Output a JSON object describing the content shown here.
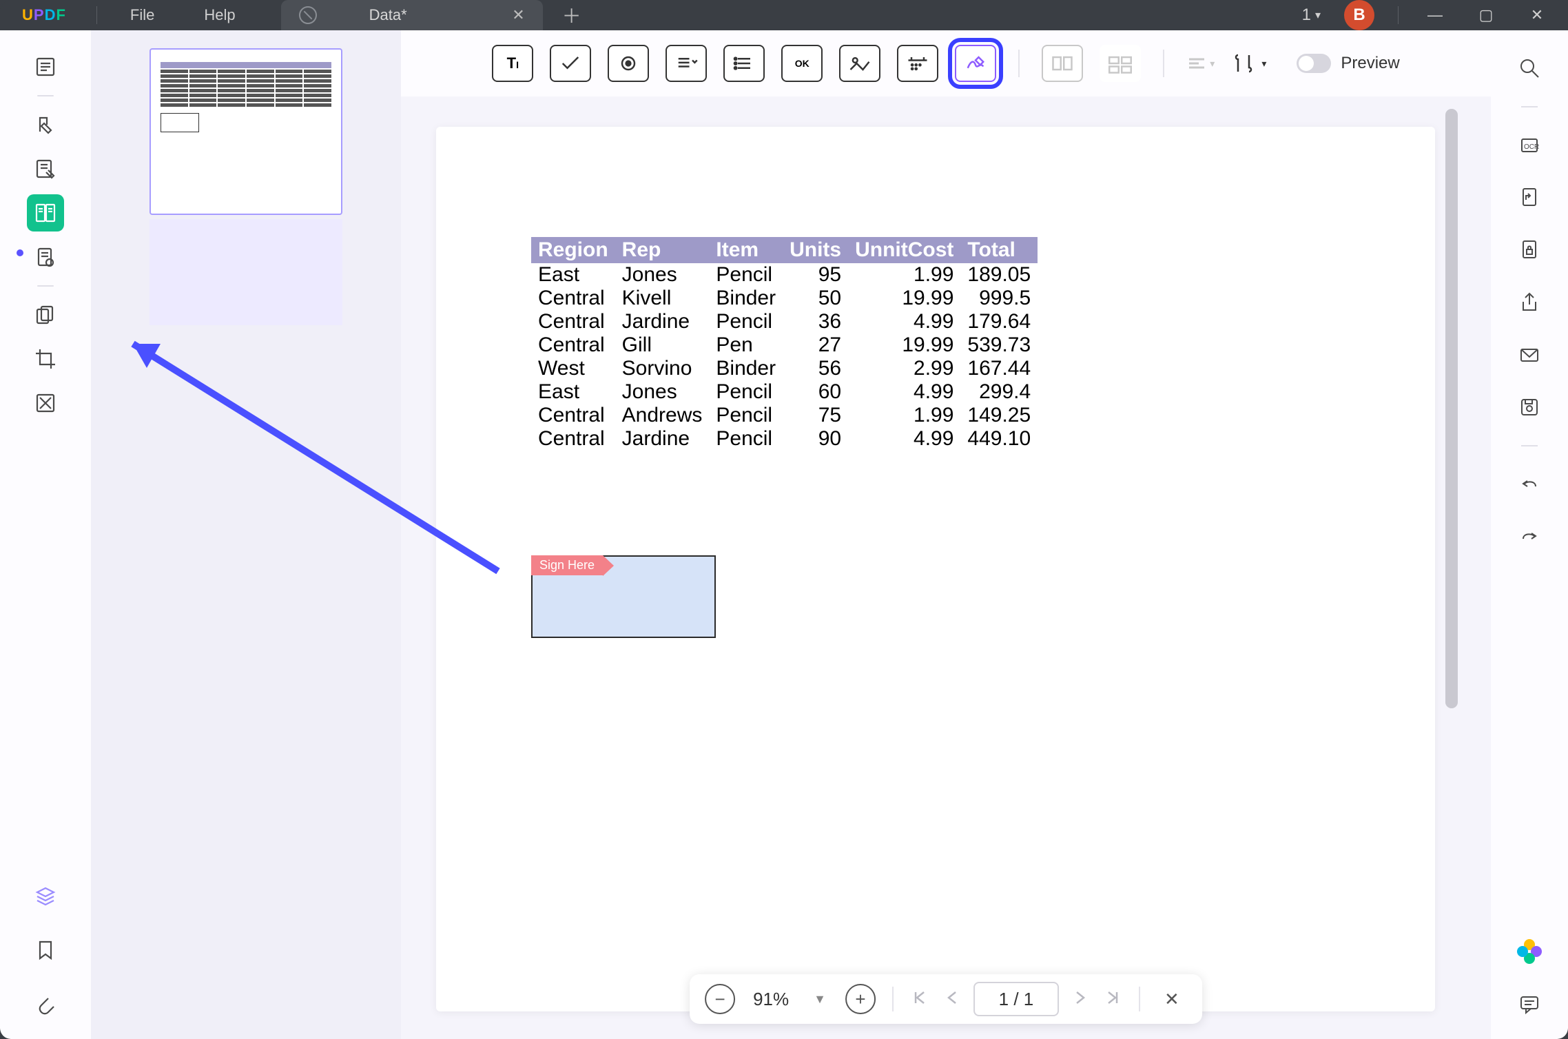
{
  "titlebar": {
    "logo": "UPDF",
    "menu_file": "File",
    "menu_help": "Help",
    "tab_title": "Data*",
    "tab_count": "1",
    "avatar_letter": "B"
  },
  "form_toolbar": {
    "text_field": "Text Field",
    "check_box": "Check Box",
    "radio": "Radio Button",
    "dropdown": "Dropdown",
    "list_box": "List Box",
    "button": "OK",
    "image": "Image Field",
    "date": "Date",
    "signature": "Signature",
    "form_recognize": "Form Field Recognition",
    "highlight_fields": "Highlight Fields",
    "alignment": "Alignment",
    "tools": "Tools",
    "preview_label": "Preview"
  },
  "document": {
    "headers": [
      "Region",
      "Rep",
      "Item",
      "Units",
      "UnnitCost",
      "Total"
    ],
    "rows": [
      [
        "East",
        "Jones",
        "Pencil",
        "95",
        "1.99",
        "189.05"
      ],
      [
        "Central",
        "Kivell",
        "Binder",
        "50",
        "19.99",
        "999.5"
      ],
      [
        "Central",
        "Jardine",
        "Pencil",
        "36",
        "4.99",
        "179.64"
      ],
      [
        "Central",
        "Gill",
        "Pen",
        "27",
        "19.99",
        "539.73"
      ],
      [
        "West",
        "Sorvino",
        "Binder",
        "56",
        "2.99",
        "167.44"
      ],
      [
        "East",
        "Jones",
        "Pencil",
        "60",
        "4.99",
        "299.4"
      ],
      [
        "Central",
        "Andrews",
        "Pencil",
        "75",
        "1.99",
        "149.25"
      ],
      [
        "Central",
        "Jardine",
        "Pencil",
        "90",
        "4.99",
        "449.10"
      ]
    ],
    "sign_label": "Sign Here"
  },
  "statusbar": {
    "zoom": "91%",
    "page_display": "1 / 1"
  },
  "left_tools": {
    "reader": "Reader",
    "comment": "Comment",
    "edit": "Edit PDF",
    "form": "Prepare Form",
    "page": "Page Tools",
    "organize": "Organize",
    "crop": "Crop",
    "redact": "Redact",
    "layers": "Layers",
    "bookmark": "Bookmarks",
    "attachment": "Attachments"
  },
  "right_tools": {
    "search": "Search",
    "ocr": "OCR",
    "convert": "Convert",
    "protect": "Protect",
    "share": "Share",
    "email": "Email",
    "save_other": "Save as Other",
    "undo": "Undo",
    "redo": "Redo",
    "ai": "AI",
    "chat": "Chat"
  }
}
